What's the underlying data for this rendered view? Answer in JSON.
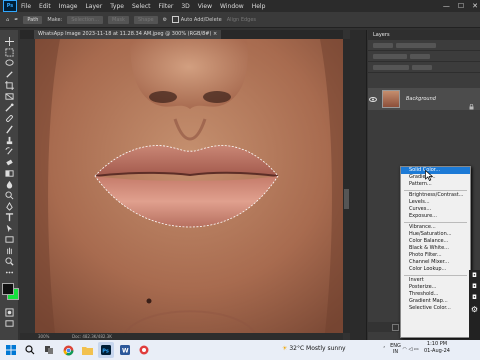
{
  "menubar": {
    "items": [
      "File",
      "Edit",
      "Image",
      "Layer",
      "Type",
      "Select",
      "Filter",
      "3D",
      "View",
      "Window",
      "Help"
    ],
    "logo": "Ps"
  },
  "options": {
    "mode": "Path",
    "make_label": "Make:",
    "selection_label": "Selection...",
    "mask_label": "Mask",
    "shape_label": "Shape",
    "auto_add_delete": "Auto Add/Delete",
    "align_edges": "Align Edges"
  },
  "document": {
    "tab_title": "WhatsApp Image 2023-11-18 at 11.28.34 AM.jpeg @ 300% (RGB/8#)",
    "zoom": "300%",
    "doc_info": "Doc: 482.3K/482.3K"
  },
  "colors": {
    "foreground": "#111111",
    "background": "#16e03e",
    "accent": "#1c7ad6"
  },
  "layers": {
    "panel_title": "Layers",
    "layer_name": "Background"
  },
  "adjust_menu": {
    "groups": [
      [
        "Solid Color...",
        "Gradient...",
        "Pattern..."
      ],
      [
        "Brightness/Contrast...",
        "Levels...",
        "Curves...",
        "Exposure..."
      ],
      [
        "Vibrance...",
        "Hue/Saturation...",
        "Color Balance...",
        "Black & White...",
        "Photo Filter...",
        "Channel Mixer...",
        "Color Lookup..."
      ],
      [
        "Invert",
        "Posterize...",
        "Threshold...",
        "Gradient Map...",
        "Selective Color..."
      ]
    ],
    "selected": "Solid Color..."
  },
  "taskbar": {
    "weather": "32°C  Mostly sunny",
    "lang_top": "ENG",
    "lang_bottom": "IN",
    "time": "1:10 PM",
    "date": "01-Aug-24"
  }
}
